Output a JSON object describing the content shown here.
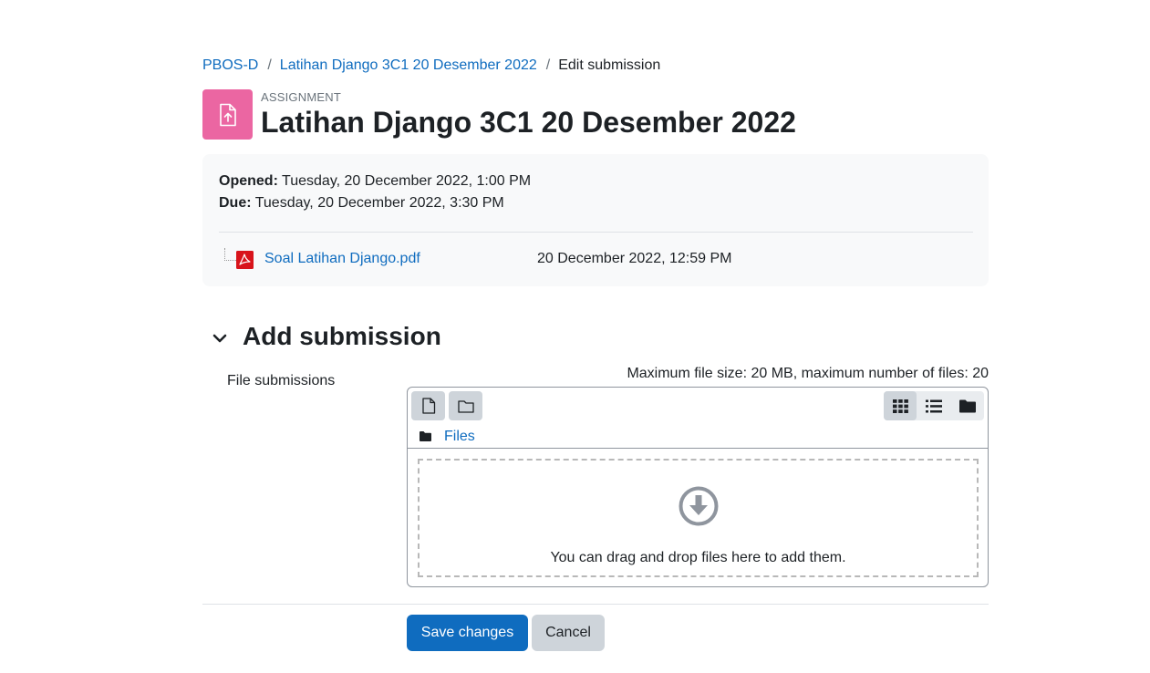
{
  "breadcrumb": {
    "items": [
      {
        "label": "PBOS-D"
      },
      {
        "label": "Latihan Django 3C1 20 Desember 2022"
      },
      {
        "label": "Edit submission"
      }
    ],
    "separator": "/"
  },
  "header": {
    "pre_title": "ASSIGNMENT",
    "title": "Latihan Django 3C1 20 Desember 2022",
    "icon": "assignment-upload-icon",
    "icon_color": "#eb66a2"
  },
  "dates": {
    "opened_label": "Opened:",
    "opened_value": "Tuesday, 20 December 2022, 1:00 PM",
    "due_label": "Due:",
    "due_value": "Tuesday, 20 December 2022, 3:30 PM"
  },
  "attachment": {
    "file_name": "Soal Latihan Django.pdf",
    "file_date": "20 December 2022, 12:59 PM",
    "icon": "pdf-icon"
  },
  "submission": {
    "section_title": "Add submission",
    "field_label": "File submissions",
    "max_info": "Maximum file size: 20 MB, maximum number of files: 20",
    "path_label": "Files",
    "drop_text": "You can drag and drop files here to add them.",
    "active_view": "icons"
  },
  "actions": {
    "save_label": "Save changes",
    "cancel_label": "Cancel"
  },
  "colors": {
    "link": "#0f6cbf",
    "primary_button": "#0f6cbf",
    "secondary_button": "#ced4da"
  }
}
